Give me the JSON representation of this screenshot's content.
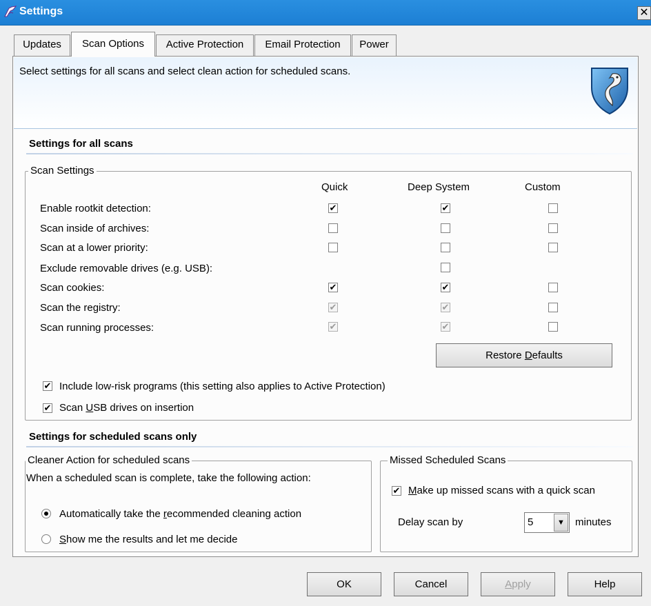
{
  "window": {
    "title": "Settings",
    "close": "✕"
  },
  "tabs": [
    "Updates",
    "Scan Options",
    "Active Protection",
    "Email Protection",
    "Power"
  ],
  "header": {
    "description": "Select settings for all scans and select clean action for scheduled scans."
  },
  "all_scans": {
    "heading": "Settings for all scans",
    "scan_settings": {
      "legend": "Scan Settings",
      "columns": [
        "Quick",
        "Deep System",
        "Custom"
      ],
      "rows": [
        {
          "label": "Enable rootkit detection:",
          "quick": "checked",
          "deep": "checked",
          "custom": "unchecked"
        },
        {
          "label": "Scan inside of archives:",
          "quick": "unchecked",
          "deep": "unchecked",
          "custom": "unchecked"
        },
        {
          "label": "Scan at a lower priority:",
          "quick": "unchecked",
          "deep": "unchecked",
          "custom": "unchecked"
        },
        {
          "label": "Exclude removable drives (e.g. USB):",
          "quick": "none",
          "deep": "unchecked",
          "custom": "none"
        },
        {
          "label": "Scan cookies:",
          "quick": "checked",
          "deep": "checked",
          "custom": "unchecked"
        },
        {
          "label": "Scan the registry:",
          "quick": "checked-disabled",
          "deep": "checked-disabled",
          "custom": "unchecked"
        },
        {
          "label": "Scan running processes:",
          "quick": "checked-disabled",
          "deep": "checked-disabled",
          "custom": "unchecked"
        }
      ],
      "restore_defaults": {
        "before": "Restore ",
        "accel": "D",
        "after": "efaults"
      },
      "include_low_risk": {
        "label": "Include low-risk programs (this setting also applies to Active Protection)",
        "checked": true
      },
      "scan_usb": {
        "before": "Scan ",
        "accel": "U",
        "after": "SB drives on insertion",
        "checked": true
      }
    }
  },
  "scheduled": {
    "heading": "Settings for scheduled scans only",
    "cleaner": {
      "legend": "Cleaner Action for scheduled scans",
      "intro": "When a scheduled scan is complete, take the following action:",
      "option_auto": {
        "before": "Automatically take the ",
        "accel": "r",
        "after": "ecommended cleaning action",
        "selected": true
      },
      "option_show": {
        "before": "",
        "accel": "S",
        "after": "how me the results and let me decide",
        "selected": false
      }
    },
    "missed": {
      "legend": "Missed Scheduled Scans",
      "makeup": {
        "before": "",
        "accel": "M",
        "after": "ake up missed scans with a quick scan",
        "checked": true
      },
      "delay_label": "Delay scan by",
      "delay_value": "5",
      "delay_unit": "minutes"
    }
  },
  "footer": {
    "ok": "OK",
    "cancel": "Cancel",
    "apply": {
      "before": "",
      "accel": "A",
      "after": "pply"
    },
    "help": "Help"
  },
  "glyphs": {
    "check": "✔",
    "dropdown": "▼"
  }
}
